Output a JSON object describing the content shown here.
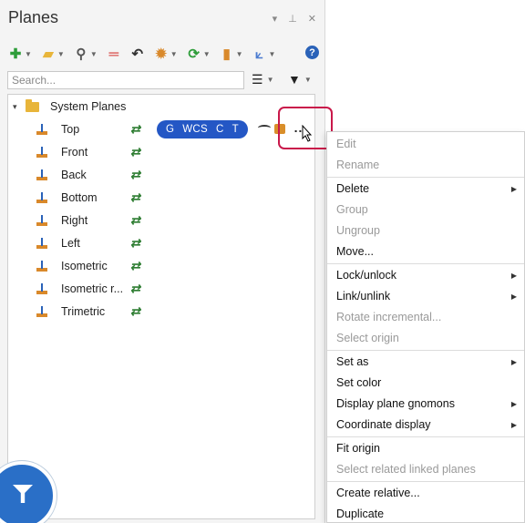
{
  "panel": {
    "title": "Planes"
  },
  "toolbar": {
    "buttons": [
      {
        "icon": "plus-icon",
        "color": "#2e9d3a"
      },
      {
        "icon": "folder-star-icon",
        "color": "#e8b53a"
      },
      {
        "icon": "search-icon",
        "color": "#555555"
      },
      {
        "icon": "equals-icon",
        "color": "#d3322f"
      },
      {
        "icon": "undo-icon",
        "color": "#333333"
      },
      {
        "icon": "gear-icon",
        "color": "#d9892b"
      },
      {
        "icon": "refresh-icon",
        "color": "#2e9d3a"
      },
      {
        "icon": "book-icon",
        "color": "#d9892b"
      },
      {
        "icon": "axes-icon",
        "color": "#4a7bd0"
      }
    ],
    "help_label": "?"
  },
  "search": {
    "placeholder": "Search..."
  },
  "tree": {
    "root_label": "System Planes",
    "items": [
      {
        "label": "Top"
      },
      {
        "label": "Front"
      },
      {
        "label": "Back"
      },
      {
        "label": "Bottom"
      },
      {
        "label": "Right"
      },
      {
        "label": "Left"
      },
      {
        "label": "Isometric"
      },
      {
        "label": "Isometric r..."
      },
      {
        "label": "Trimetric"
      }
    ],
    "tags": [
      "G",
      "WCS",
      "C",
      "T"
    ],
    "more_label": "..."
  },
  "context_menu": {
    "items": [
      {
        "label": "Edit",
        "disabled": true,
        "submenu": false
      },
      {
        "label": "Rename",
        "disabled": true,
        "submenu": false
      },
      {
        "label": "Delete",
        "disabled": false,
        "submenu": true
      },
      {
        "label": "Group",
        "disabled": true,
        "submenu": false
      },
      {
        "label": "Ungroup",
        "disabled": true,
        "submenu": false
      },
      {
        "label": "Move...",
        "disabled": false,
        "submenu": false
      },
      {
        "label": "Lock/unlock",
        "disabled": false,
        "submenu": true
      },
      {
        "label": "Link/unlink",
        "disabled": false,
        "submenu": true
      },
      {
        "label": "Rotate incremental...",
        "disabled": true,
        "submenu": false
      },
      {
        "label": "Select origin",
        "disabled": true,
        "submenu": false
      },
      {
        "label": "Set as",
        "disabled": false,
        "submenu": true
      },
      {
        "label": "Set color",
        "disabled": false,
        "submenu": false
      },
      {
        "label": "Display plane gnomons",
        "disabled": false,
        "submenu": true
      },
      {
        "label": "Coordinate display",
        "disabled": false,
        "submenu": true
      },
      {
        "label": "Fit origin",
        "disabled": false,
        "submenu": false
      },
      {
        "label": "Select related linked planes",
        "disabled": true,
        "submenu": false
      },
      {
        "label": "Create relative...",
        "disabled": false,
        "submenu": false
      },
      {
        "label": "Duplicate",
        "disabled": false,
        "submenu": false
      }
    ]
  },
  "colors": {
    "accent": "#2457c5",
    "highlight": "#c9184a",
    "disabled_text": "#9a9a9a"
  }
}
